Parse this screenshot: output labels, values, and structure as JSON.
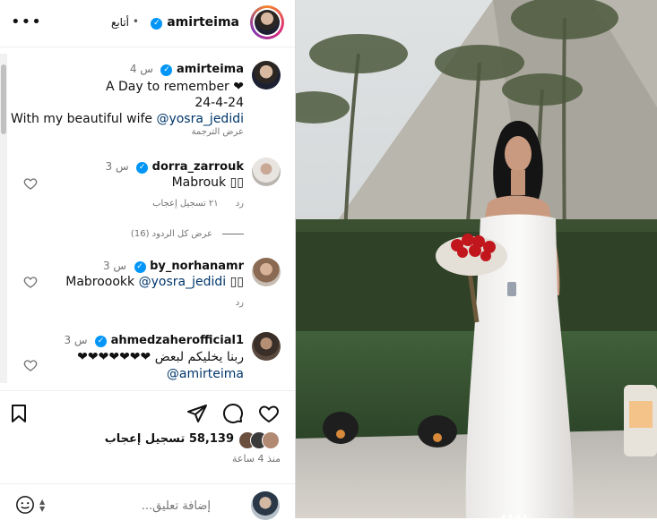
{
  "header": {
    "username": "amirteima",
    "separator": "•",
    "follow_label": "أتابع",
    "more_label": "•••"
  },
  "caption": {
    "username": "amirteima",
    "time": "4 س",
    "line1": "A Day to remember ❤",
    "line2": "24-4-24",
    "line3_text": "With my beautiful wife ",
    "line3_mention": "@yosra_jedidi",
    "translate_label": "عرض الترجمة"
  },
  "comments": [
    {
      "username": "dorra_zarrouk",
      "time": "3 س",
      "text": "Mabrouk ▯▯",
      "likes_label": "٢١ تسجيل إعجاب",
      "reply_label": "رد",
      "view_replies": "عرض كل الردود (16)"
    },
    {
      "username": "by_norhanamr",
      "time": "3 س",
      "text": "Mabroookk ",
      "mention": "@yosra_jedidi",
      "suffix": " ▯▯",
      "reply_label": "رد"
    },
    {
      "username": "ahmedzaherofficial1",
      "time": "3 س",
      "text": "ربنا يخليكم لبعض ❤❤❤❤❤❤❤",
      "mention": "@amirteima"
    }
  ],
  "likes": {
    "count": "58,139",
    "label": "تسجيل إعجاب"
  },
  "posted_ago": "منذ 4 ساعة",
  "comment_input": {
    "placeholder": "إضافة تعليق..."
  },
  "icons": [
    "bookmark-icon",
    "share-icon",
    "comment-icon",
    "heart-icon",
    "emoji-icon",
    "more-icon",
    "verified-badge-icon"
  ],
  "colors": {
    "verified": "#0095f6",
    "link": "#00376b",
    "secondary_text": "#737373"
  }
}
